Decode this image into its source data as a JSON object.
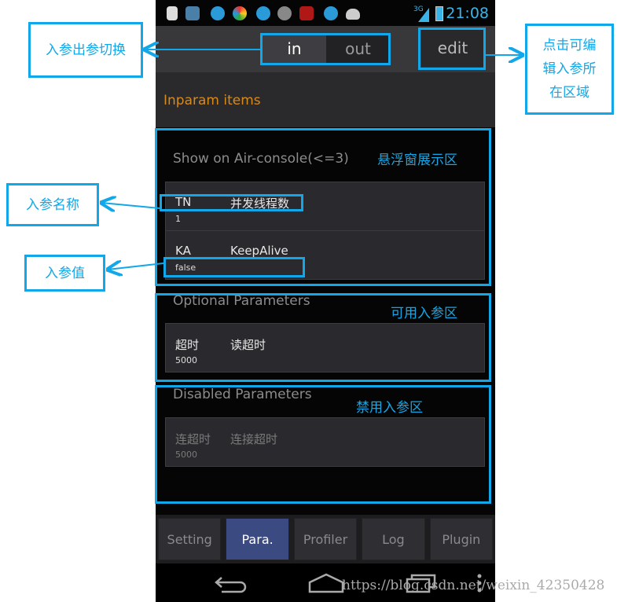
{
  "status_bar": {
    "time": "21:08",
    "network": "3G"
  },
  "action_bar": {
    "toggle": [
      {
        "label": "in",
        "selected": true
      },
      {
        "label": "out",
        "selected": false
      }
    ],
    "edit_label": "edit"
  },
  "header": {
    "title": "Inparam items",
    "title_color": "#d78a1c"
  },
  "sections": {
    "floating": {
      "title": "Show on Air-console(<=3)",
      "items": [
        {
          "key": "TN",
          "name": "并发线程数",
          "value": "1"
        },
        {
          "key": "KA",
          "name": "KeepAlive",
          "value": "false"
        }
      ]
    },
    "optional": {
      "title": "Optional Parameters",
      "items": [
        {
          "key": "超时",
          "name": "读超时",
          "value": "5000"
        }
      ]
    },
    "disabled": {
      "title": "Disabled Parameters",
      "items": [
        {
          "key": "连超时",
          "name": "连接超时",
          "value": "5000"
        }
      ]
    }
  },
  "tabs": [
    {
      "label": "Setting"
    },
    {
      "label": "Para.",
      "selected": true
    },
    {
      "label": "Profiler"
    },
    {
      "label": "Log"
    },
    {
      "label": "Plugin"
    }
  ],
  "annotations": {
    "switch": "入参出参切换",
    "edit": [
      "点击可编",
      "辑入参所",
      "在区域"
    ],
    "floating": "悬浮窗展示区",
    "param_name": "入参名称",
    "param_value": "入参值",
    "optional": "可用入参区",
    "disabled": "禁用入参区",
    "color": "#12a7e8"
  },
  "watermark": "https://blog.csdn.net/weixin_42350428"
}
